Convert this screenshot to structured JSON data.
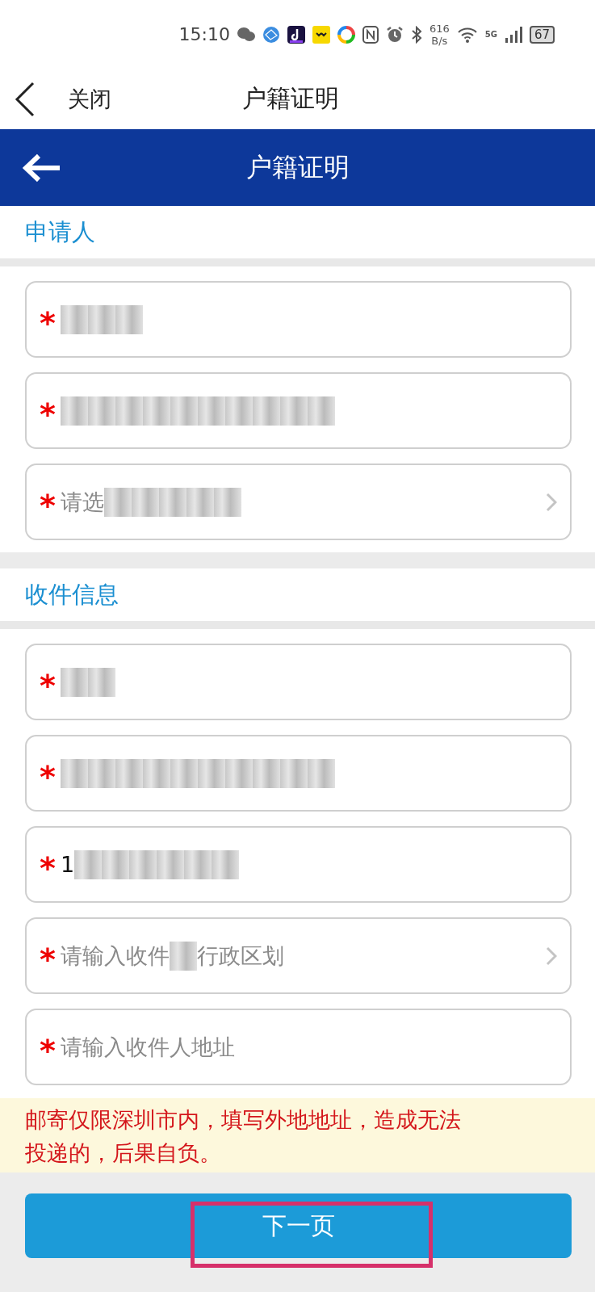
{
  "status_bar": {
    "time": "15:10",
    "speed_value": "616",
    "speed_unit": "B/s",
    "network": "5G",
    "battery": "67"
  },
  "nav_bar": {
    "close_label": "关闭",
    "title": "户籍证明"
  },
  "header": {
    "title": "户籍证明"
  },
  "sections": [
    {
      "title": "申请人",
      "fields": [
        {
          "kind": "text",
          "required_mark": "*",
          "parts": [
            {
              "kind": "redacted"
            },
            {
              "kind": "redacted"
            },
            {
              "kind": "redacted"
            }
          ]
        },
        {
          "kind": "text",
          "required_mark": "*",
          "parts": [
            {
              "kind": "redacted"
            },
            {
              "kind": "redacted"
            },
            {
              "kind": "redacted"
            },
            {
              "kind": "redacted"
            },
            {
              "kind": "redacted"
            },
            {
              "kind": "redacted"
            },
            {
              "kind": "redacted"
            },
            {
              "kind": "redacted"
            },
            {
              "kind": "redacted"
            },
            {
              "kind": "redacted"
            }
          ]
        },
        {
          "kind": "select",
          "required_mark": "*",
          "placeholder": true,
          "parts": [
            {
              "kind": "text",
              "text": "请选"
            },
            {
              "kind": "redacted"
            },
            {
              "kind": "redacted"
            },
            {
              "kind": "redacted"
            },
            {
              "kind": "redacted"
            },
            {
              "kind": "redacted"
            }
          ]
        }
      ]
    },
    {
      "title": "收件信息",
      "fields": [
        {
          "kind": "text",
          "required_mark": "*",
          "parts": [
            {
              "kind": "redacted"
            },
            {
              "kind": "redacted"
            }
          ]
        },
        {
          "kind": "text",
          "required_mark": "*",
          "parts": [
            {
              "kind": "redacted"
            },
            {
              "kind": "redacted"
            },
            {
              "kind": "redacted"
            },
            {
              "kind": "redacted"
            },
            {
              "kind": "redacted"
            },
            {
              "kind": "redacted"
            },
            {
              "kind": "redacted"
            },
            {
              "kind": "redacted"
            },
            {
              "kind": "redacted"
            },
            {
              "kind": "redacted"
            }
          ]
        },
        {
          "kind": "text",
          "required_mark": "*",
          "placeholder": false,
          "parts": [
            {
              "kind": "text",
              "text": "1"
            },
            {
              "kind": "redacted"
            },
            {
              "kind": "redacted"
            },
            {
              "kind": "redacted"
            },
            {
              "kind": "redacted"
            },
            {
              "kind": "redacted"
            },
            {
              "kind": "redacted"
            }
          ]
        },
        {
          "kind": "select",
          "required_mark": "*",
          "placeholder": true,
          "parts": [
            {
              "kind": "text",
              "text": "请输入收件"
            },
            {
              "kind": "redacted"
            },
            {
              "kind": "text",
              "text": "行政区划"
            }
          ]
        },
        {
          "kind": "text",
          "required_mark": "*",
          "placeholder": true,
          "parts": [
            {
              "kind": "text",
              "text": "请输入收件人地址"
            }
          ]
        }
      ]
    }
  ],
  "notice": "邮寄仅限深圳市内，填写外地地址，造成无法投递的，后果自负。",
  "next_button": {
    "label": "下一页",
    "highlighted": true
  }
}
